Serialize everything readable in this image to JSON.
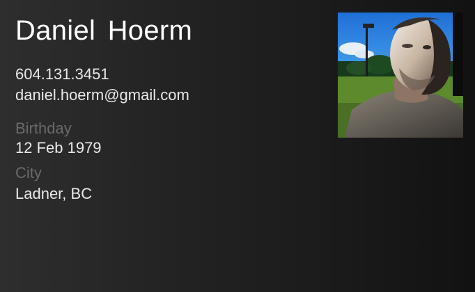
{
  "contact": {
    "name": "Daniel  Hoerm",
    "phone": "604.131.3451",
    "email": "daniel.hoerm@gmail.com",
    "birthday_label": "Birthday",
    "birthday": "12 Feb 1979",
    "city_label": "City",
    "city": "Ladner, BC"
  },
  "photo": {
    "icon": "contact-photo"
  }
}
